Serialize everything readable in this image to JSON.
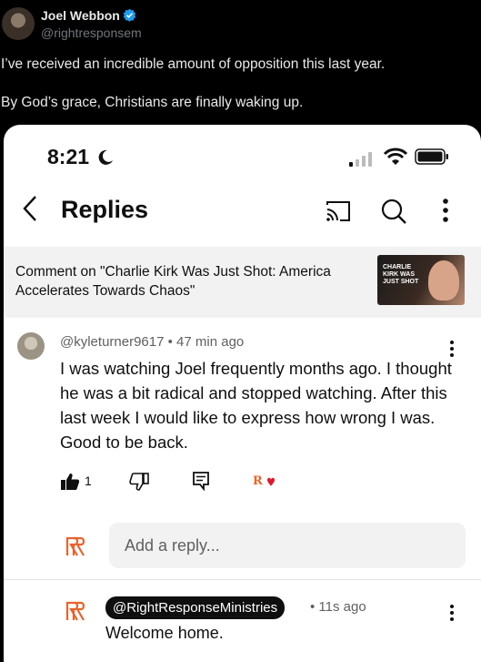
{
  "tweet": {
    "author_name": "Joel Webbon",
    "handle": "@rightresponsem",
    "line1": "I’ve received an incredible amount of opposition this last year.",
    "line2": "By God’s grace, Christians are finally waking up."
  },
  "status_bar": {
    "time": "8:21"
  },
  "header": {
    "title": "Replies"
  },
  "context": {
    "text": "Comment on \"Charlie Kirk Was Just Shot: America Accelerates Towards Chaos\"",
    "thumb_text": "CHARLIE KIRK WAS JUST SHOT"
  },
  "comment": {
    "meta": "@kyleturner9617 • 47 min ago",
    "body": "I was watching Joel frequently months ago. I thought he was a bit radical and stopped watching. After this last week I would like to express how wrong I was. Good to be back.",
    "like_count": "1"
  },
  "reply_input": {
    "placeholder": "Add a reply..."
  },
  "reply": {
    "handle": "@RightResponseMinistries",
    "time": "• 11s ago",
    "body": "Welcome home."
  },
  "colors": {
    "accent": "#e8632b",
    "verified": "#1d9bf0",
    "heart": "#e0182d"
  }
}
